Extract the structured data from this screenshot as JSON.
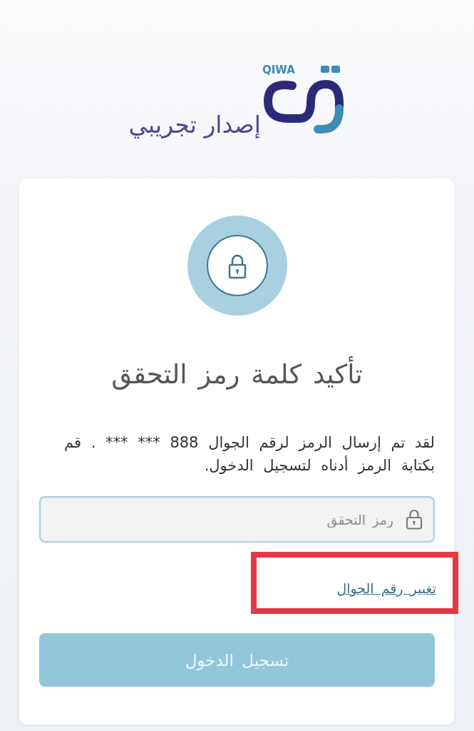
{
  "logo": {
    "wordmark": "QIWA",
    "subtitle": "إصدار تجريبي"
  },
  "card": {
    "title": "تأكيد كلمة رمز التحقق",
    "message": "لقد تم إرسال الرمز لرقم الجوال 888 *** *** . قم بكتابة الرمز أدناه لتسجيل الدخول.",
    "code_field": {
      "placeholder": "رمز التحقق"
    },
    "change_number_link": {
      "label": "تغيير رقم الجوال",
      "highlighted": true
    },
    "login_button": {
      "label": "تسجيل الدخول",
      "disabled": true
    }
  }
}
